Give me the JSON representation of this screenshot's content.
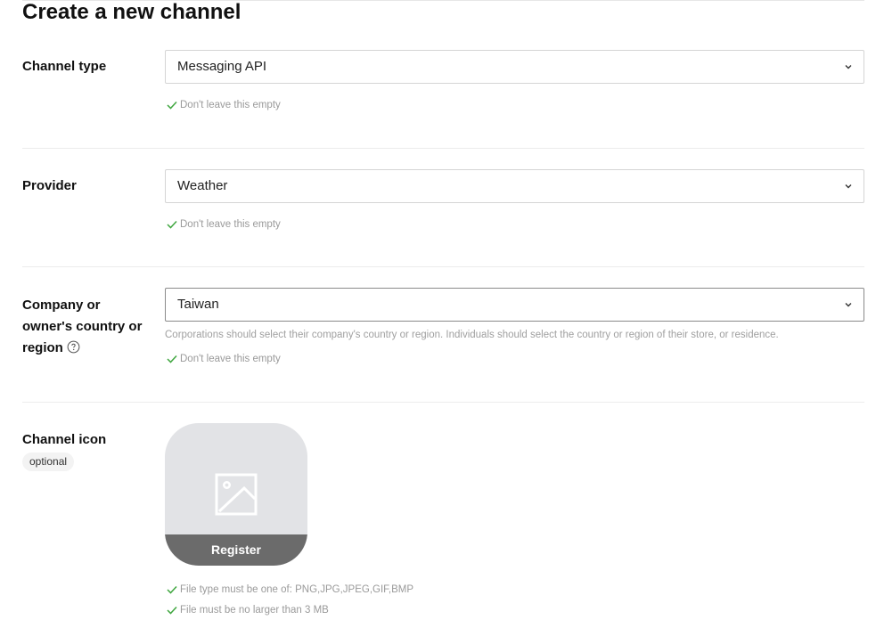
{
  "page": {
    "title": "Create a new channel"
  },
  "channel_type": {
    "label": "Channel type",
    "value": "Messaging API",
    "validation": "Don't leave this empty"
  },
  "provider": {
    "label": "Provider",
    "value": "Weather",
    "validation": "Don't leave this empty"
  },
  "country": {
    "label_lines": [
      "Company or",
      "owner's country or",
      "region"
    ],
    "value": "Taiwan",
    "helper": "Corporations should select their company's country or region. Individuals should select the country or region of their store, or residence.",
    "validation": "Don't leave this empty"
  },
  "channel_icon": {
    "label": "Channel icon",
    "optional": "optional",
    "register_label": "Register",
    "rules": [
      "File type must be one of: PNG,JPG,JPEG,GIF,BMP",
      "File must be no larger than 3 MB"
    ]
  },
  "colors": {
    "valid_check": "#3fa63f",
    "input_border": "#d5d5d5",
    "register_bg": "#6b6b6b",
    "uploader_bg": "#e2e3e6"
  },
  "icons": [
    "chevron-down-icon",
    "check-icon",
    "help-circle-icon",
    "image-placeholder-icon"
  ]
}
